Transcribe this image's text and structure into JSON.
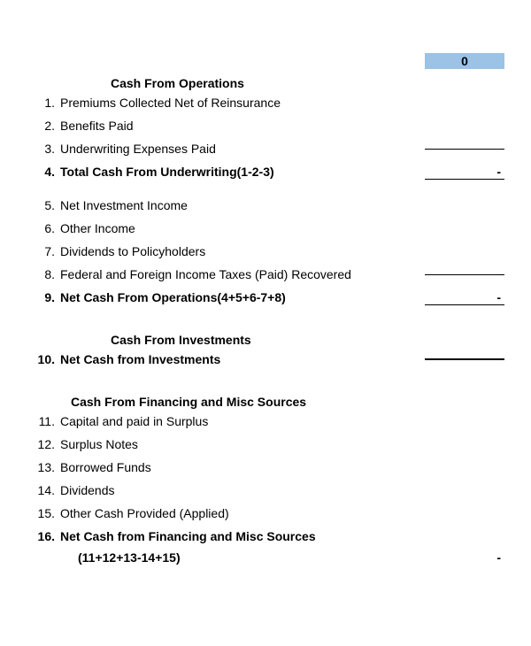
{
  "top_value": "0",
  "section1": {
    "title": "Cash From Operations",
    "items": [
      {
        "num": "1.",
        "label": "Premiums Collected Net of Reinsurance"
      },
      {
        "num": "2.",
        "label": "Benefits Paid"
      },
      {
        "num": "3.",
        "label": "Underwriting Expenses Paid"
      }
    ],
    "total1": {
      "num": "4.",
      "label": "Total Cash From Underwriting(1-2-3)",
      "val": "-"
    },
    "items2": [
      {
        "num": "5.",
        "label": "Net Investment Income"
      },
      {
        "num": "6.",
        "label": "Other Income"
      },
      {
        "num": "7.",
        "label": "Dividends to Policyholders"
      },
      {
        "num": "8.",
        "label": "Federal and Foreign Income Taxes (Paid) Recovered"
      }
    ],
    "total2": {
      "num": "9.",
      "label": "Net Cash From Operations(4+5+6-7+8)",
      "val": "-"
    }
  },
  "section2": {
    "title": "Cash From Investments",
    "total": {
      "num": "10.",
      "label": "Net Cash from Investments",
      "val": ""
    }
  },
  "section3": {
    "title": "Cash From Financing and Misc Sources",
    "items": [
      {
        "num": "11.",
        "label": "Capital and paid in Surplus"
      },
      {
        "num": "12.",
        "label": "Surplus Notes"
      },
      {
        "num": "13.",
        "label": "Borrowed Funds"
      },
      {
        "num": "14.",
        "label": "Dividends"
      },
      {
        "num": "15.",
        "label": "Other Cash Provided (Applied)"
      }
    ],
    "total": {
      "num": "16.",
      "label": "Net Cash from Financing and Misc Sources",
      "formula": "(11+12+13-14+15)",
      "val": "-"
    }
  }
}
